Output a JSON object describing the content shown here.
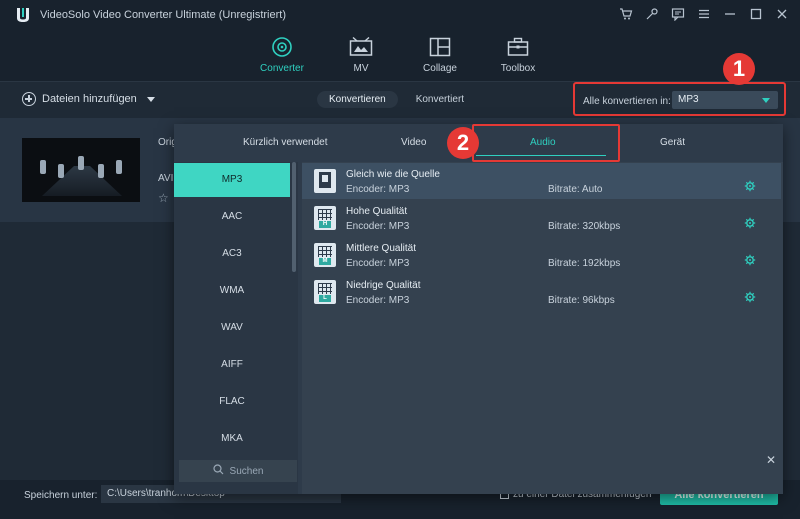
{
  "app": {
    "title": "VideoSolo Video Converter Ultimate (Unregistriert)"
  },
  "nav": {
    "tabs": [
      {
        "label": "Converter",
        "icon": "converter-icon"
      },
      {
        "label": "MV",
        "icon": "mv-icon"
      },
      {
        "label": "Collage",
        "icon": "collage-icon"
      },
      {
        "label": "Toolbox",
        "icon": "toolbox-icon"
      }
    ],
    "active": "Converter"
  },
  "toolbar": {
    "add_files": "Dateien hinzufügen",
    "seg_converting": "Konvertieren",
    "seg_converted": "Konvertiert",
    "convert_all_label": "Alle konvertieren in:",
    "convert_all_value": "MP3"
  },
  "annotations": {
    "badge1": "1",
    "badge2": "2"
  },
  "file": {
    "name_partial": "Orig",
    "format_partial": "AVI"
  },
  "format_panel": {
    "tabs": [
      "Kürzlich verwendet",
      "Video",
      "Audio",
      "Gerät"
    ],
    "active_tab": "Audio",
    "formats": [
      "MP3",
      "AAC",
      "AC3",
      "WMA",
      "WAV",
      "AIFF",
      "FLAC",
      "MKA"
    ],
    "active_format": "MP3",
    "search_placeholder": "Suchen",
    "presets": [
      {
        "name": "Gleich wie die Quelle",
        "encoder": "Encoder: MP3",
        "bitrate": "Bitrate: Auto",
        "tag": ""
      },
      {
        "name": "Hohe Qualität",
        "encoder": "Encoder: MP3",
        "bitrate": "Bitrate: 320kbps",
        "tag": "H"
      },
      {
        "name": "Mittlere Qualität",
        "encoder": "Encoder: MP3",
        "bitrate": "Bitrate: 192kbps",
        "tag": "M"
      },
      {
        "name": "Niedrige Qualität",
        "encoder": "Encoder: MP3",
        "bitrate": "Bitrate: 96kbps",
        "tag": "L"
      }
    ]
  },
  "bottom": {
    "save_label": "Speichern unter:",
    "save_path": "C:\\Users\\tranhom\\Desktop",
    "merge_label": "zu einer Datei zusammenfügen",
    "convert_button": "Alle konvertieren"
  },
  "colors": {
    "accent": "#2fd0c0",
    "highlight": "#e53935",
    "background": "#1f2a36"
  }
}
